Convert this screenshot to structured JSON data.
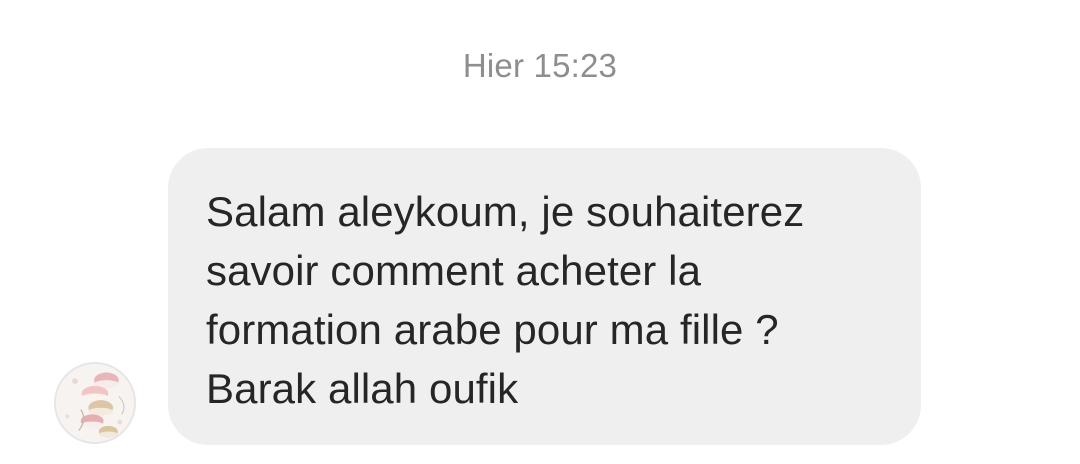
{
  "conversation": {
    "timestamp": "Hier 15:23",
    "message": {
      "text": "Salam aleykoum, je souhaiterez\nsavoir comment acheter la\nformation arabe pour ma fille ?\nBarak allah oufik"
    },
    "sender": {
      "avatar_icon": "profile-photo-macarons"
    },
    "colors": {
      "bubble_background": "#efefef",
      "timestamp_text": "#8e8e8e",
      "message_text": "#262626"
    }
  }
}
